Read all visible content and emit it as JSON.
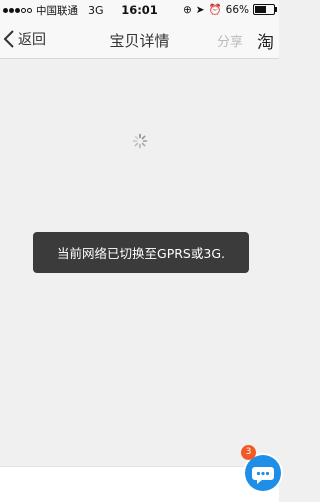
{
  "status_bar": {
    "carrier": "中国联通",
    "network": "3G",
    "time": "16:01",
    "battery_text": "66%",
    "battery_level": 0.66
  },
  "nav": {
    "back_label": "返回",
    "title": "宝贝详情",
    "share_label": "分享",
    "store_icon_glyph": "淘"
  },
  "toast": {
    "message": "当前网络已切换至GPRS或3G."
  },
  "chat": {
    "badge_count": "3"
  },
  "colors": {
    "accent": "#1f8ee6",
    "badge": "#f15a22",
    "toast_bg": "#3b3b3b"
  }
}
